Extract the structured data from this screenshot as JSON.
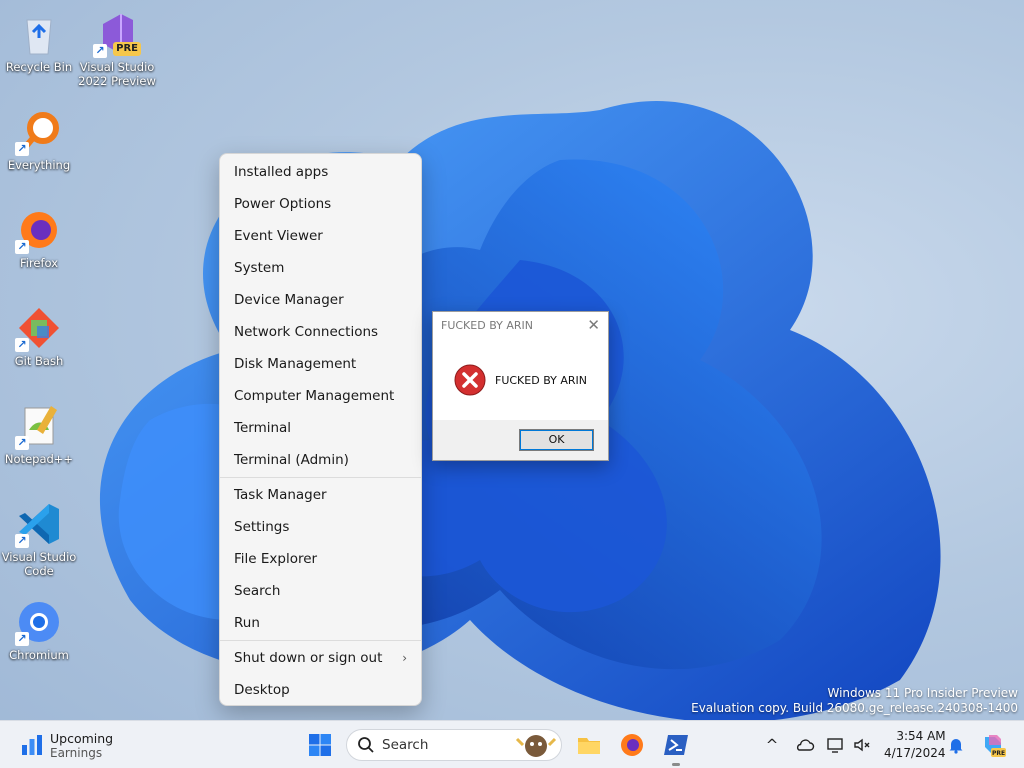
{
  "desktop": {
    "icons": [
      {
        "label": "Recycle Bin"
      },
      {
        "label": "Visual Studio 2022 Preview"
      },
      {
        "label": "Everything"
      },
      {
        "label": "Firefox"
      },
      {
        "label": "Git Bash"
      },
      {
        "label": "Notepad++"
      },
      {
        "label": "Visual Studio Code"
      },
      {
        "label": "Chromium"
      }
    ],
    "vs_badge": "PRE"
  },
  "context_menu": {
    "items": [
      {
        "label": "Installed apps"
      },
      {
        "label": "Power Options"
      },
      {
        "label": "Event Viewer"
      },
      {
        "label": "System"
      },
      {
        "label": "Device Manager"
      },
      {
        "label": "Network Connections"
      },
      {
        "label": "Disk Management"
      },
      {
        "label": "Computer Management"
      },
      {
        "label": "Terminal"
      },
      {
        "label": "Terminal (Admin)"
      },
      {
        "label": "Task Manager"
      },
      {
        "label": "Settings"
      },
      {
        "label": "File Explorer"
      },
      {
        "label": "Search"
      },
      {
        "label": "Run"
      },
      {
        "label": "Shut down or sign out"
      },
      {
        "label": "Desktop"
      }
    ],
    "submenu_chevron": "›"
  },
  "message_box": {
    "title": "FUCKED BY ARIN",
    "message": "FUCKED BY ARIN",
    "ok_label": "OK",
    "close_glyph": "✕"
  },
  "watermark": {
    "line1": "Windows 11 Pro Insider Preview",
    "line2": "Evaluation copy. Build 26080.ge_release.240308-1400"
  },
  "taskbar": {
    "widget_title": "Upcoming",
    "widget_subtitle": "Earnings",
    "search_placeholder": "Search",
    "clock_time": "3:54 AM",
    "clock_date": "4/17/2024",
    "tray_chevron": "^"
  },
  "colors": {
    "accent": "#0078d7",
    "error_red": "#d32f2f",
    "bloom_blue": "#1f6fe8"
  }
}
